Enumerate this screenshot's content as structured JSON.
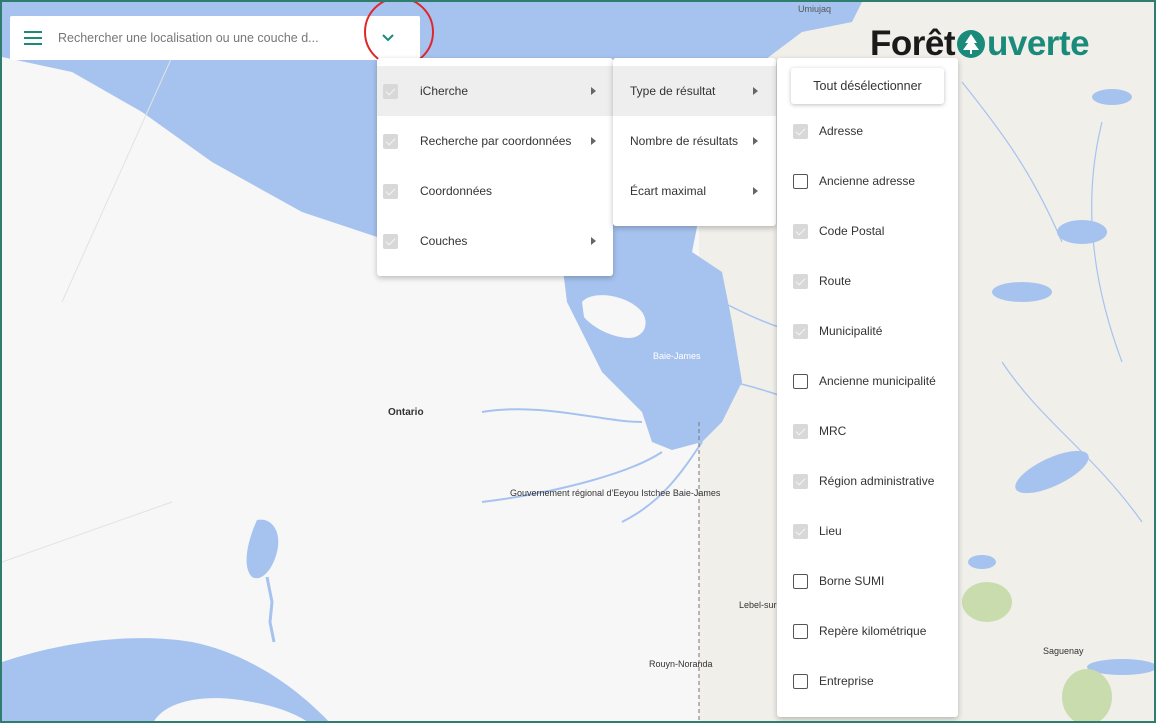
{
  "search": {
    "placeholder": "Rechercher une localisation ou une couche d..."
  },
  "logo": {
    "part1": "Forêt",
    "part2": "uverte"
  },
  "map_labels": {
    "top": "Umiujaq",
    "ontario": "Ontario",
    "baie_james_water": "Baie-James",
    "eeyou": "Gouvernement régional d'Eeyou Istchee Baie-James",
    "lebel": "Lebel-sur-",
    "rouyn": "Rouyn-Noranda",
    "saguenay": "Saguenay"
  },
  "menu1": {
    "items": [
      {
        "label": "iCherche",
        "has_submenu": true,
        "active": true
      },
      {
        "label": "Recherche par coordonnées",
        "has_submenu": true
      },
      {
        "label": "Coordonnées",
        "has_submenu": false
      },
      {
        "label": "Couches",
        "has_submenu": true
      }
    ]
  },
  "menu2": {
    "items": [
      {
        "label": "Type de résultat",
        "has_submenu": true,
        "active": true
      },
      {
        "label": "Nombre de résultats",
        "has_submenu": true
      },
      {
        "label": "Écart maximal",
        "has_submenu": true
      }
    ]
  },
  "menu3": {
    "deselect_label": "Tout désélectionner",
    "items": [
      {
        "label": "Adresse",
        "state": "checked-disabled"
      },
      {
        "label": "Ancienne adresse",
        "state": "unchecked"
      },
      {
        "label": "Code Postal",
        "state": "checked-disabled"
      },
      {
        "label": "Route",
        "state": "checked-disabled"
      },
      {
        "label": "Municipalité",
        "state": "checked-disabled"
      },
      {
        "label": "Ancienne municipalité",
        "state": "unchecked"
      },
      {
        "label": "MRC",
        "state": "checked-disabled"
      },
      {
        "label": "Région administrative",
        "state": "checked-disabled"
      },
      {
        "label": "Lieu",
        "state": "checked-disabled"
      },
      {
        "label": "Borne SUMI",
        "state": "unchecked"
      },
      {
        "label": "Repère kilométrique",
        "state": "unchecked"
      },
      {
        "label": "Entreprise",
        "state": "unchecked"
      }
    ]
  },
  "colors": {
    "water": "#a6c3ef",
    "land": "#f7f7f7",
    "land_quebec": "#f1efe9",
    "accent": "#1a8a7a",
    "highlight": "#e0262b"
  },
  "icons": {
    "menu": "hamburger-menu-icon",
    "dropdown": "chevron-down-icon",
    "submenu": "caret-right-icon"
  }
}
